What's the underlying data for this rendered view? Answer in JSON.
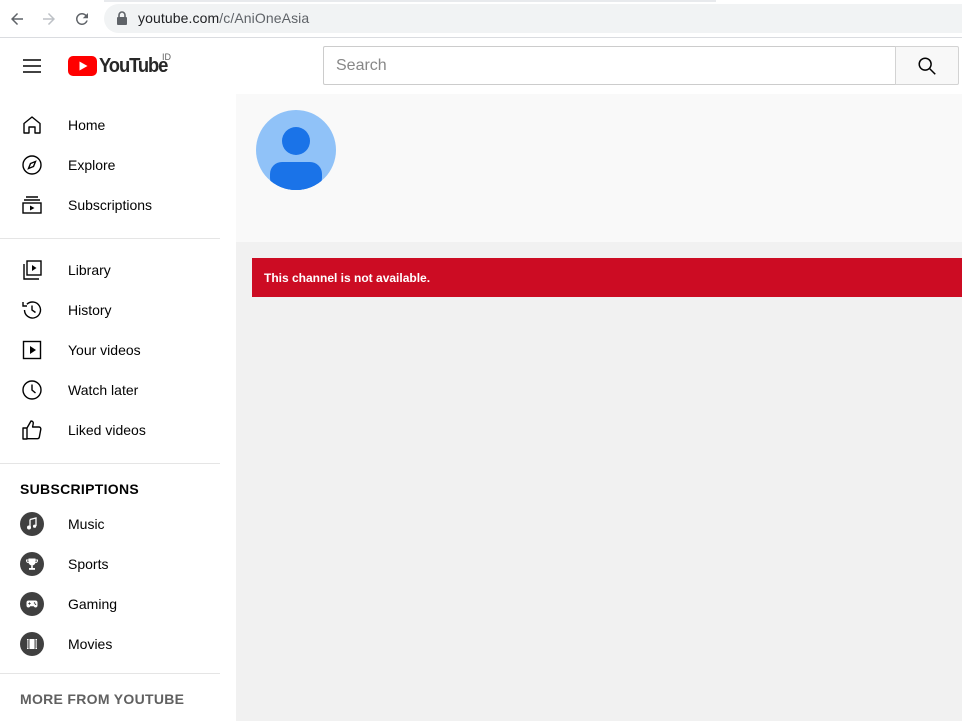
{
  "browser": {
    "url_host": "youtube.com",
    "url_path": "/c/AniOneAsia"
  },
  "masthead": {
    "logo_text": "YouTube",
    "country_code": "ID",
    "search_placeholder": "Search"
  },
  "sidebar": {
    "main_items": [
      {
        "label": "Home",
        "icon": "home-icon"
      },
      {
        "label": "Explore",
        "icon": "compass-icon"
      },
      {
        "label": "Subscriptions",
        "icon": "subscriptions-icon"
      }
    ],
    "library_items": [
      {
        "label": "Library",
        "icon": "library-icon"
      },
      {
        "label": "History",
        "icon": "history-icon"
      },
      {
        "label": "Your videos",
        "icon": "your-videos-icon"
      },
      {
        "label": "Watch later",
        "icon": "watch-later-icon"
      },
      {
        "label": "Liked videos",
        "icon": "thumbs-up-icon"
      }
    ],
    "subscriptions_title": "SUBSCRIPTIONS",
    "subscriptions": [
      {
        "label": "Music",
        "icon": "music-note-icon"
      },
      {
        "label": "Sports",
        "icon": "trophy-icon"
      },
      {
        "label": "Gaming",
        "icon": "gamepad-icon"
      },
      {
        "label": "Movies",
        "icon": "film-icon"
      }
    ],
    "more_title": "MORE FROM YOUTUBE"
  },
  "main": {
    "alert_message": "This channel is not available."
  },
  "colors": {
    "brand_red": "#ff0000",
    "alert_red": "#cc0c23",
    "avatar_bg": "#90c2f8",
    "avatar_fg": "#1a73e8"
  }
}
